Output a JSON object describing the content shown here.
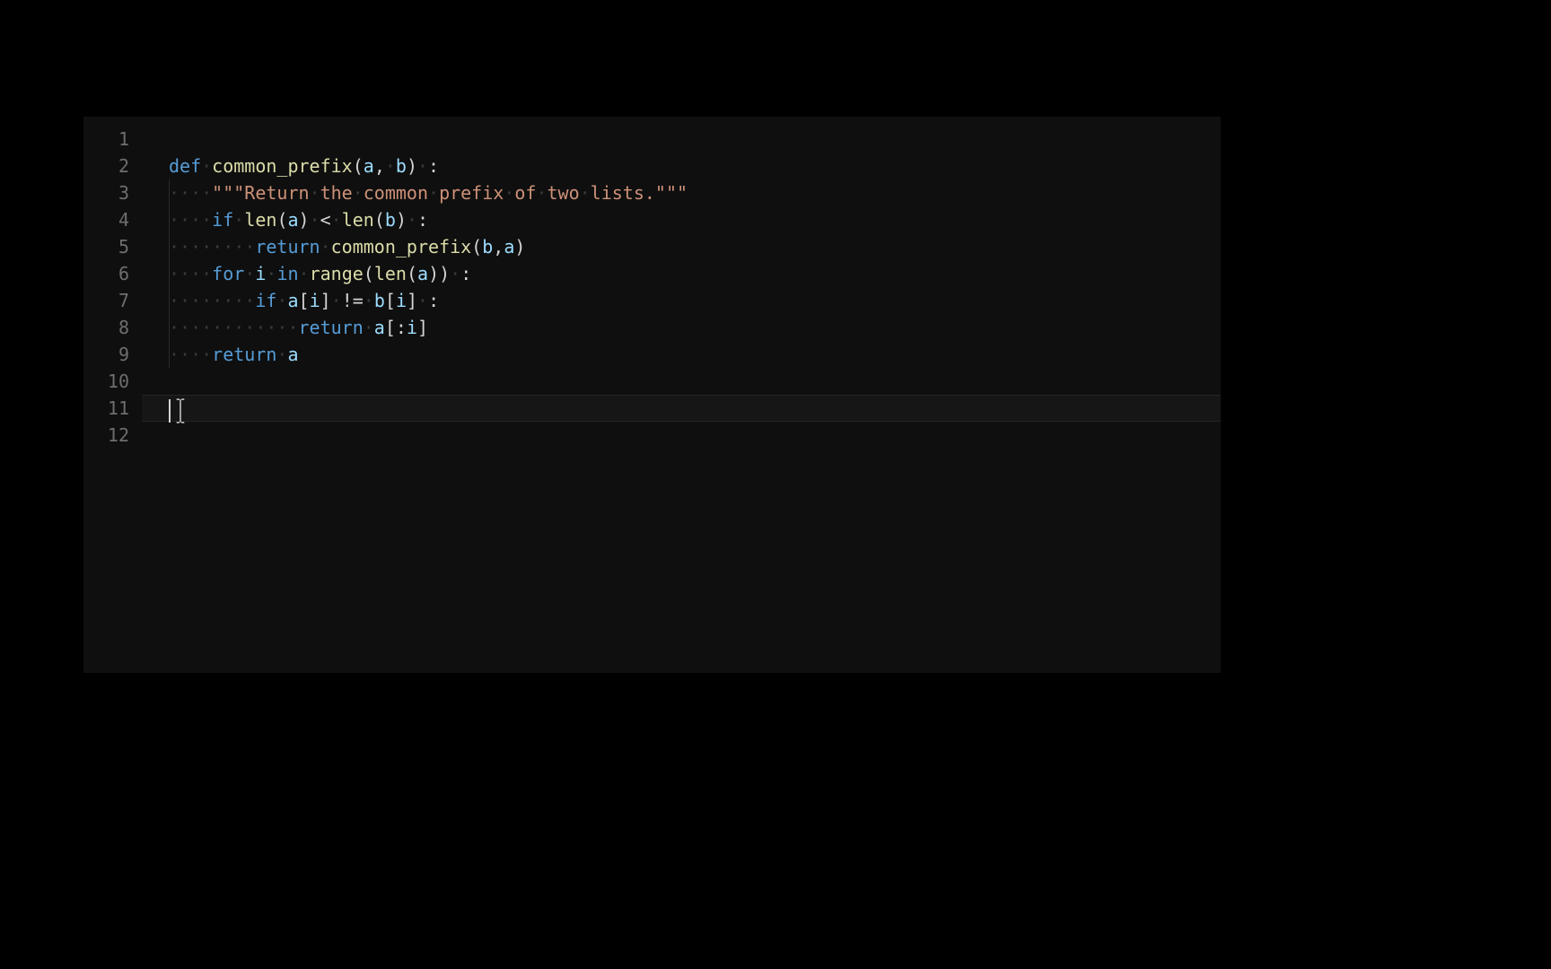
{
  "editor": {
    "active_line": 11,
    "gutter": [
      "1",
      "2",
      "3",
      "4",
      "5",
      "6",
      "7",
      "8",
      "9",
      "10",
      "11",
      "12"
    ],
    "code": {
      "line1": "",
      "line2": {
        "def": "def",
        "sp": " ",
        "fn": "common_prefix",
        "open": "(",
        "a": "a",
        "comma": ",",
        "sp2": " ",
        "b": "b",
        "close": ")",
        "sp3": " ",
        "colon": ":"
      },
      "line3": {
        "indent": "····",
        "docstring": "\"\"\"Return the common prefix of two lists.\"\"\""
      },
      "line4": {
        "indent": "····",
        "if": "if",
        "sp": " ",
        "len1": "len",
        "openA": "(",
        "a": "a",
        "closeA": ")",
        "sp2": " ",
        "lt": "<",
        "sp3": " ",
        "len2": "len",
        "openB": "(",
        "b": "b",
        "closeB": ")",
        "sp4": " ",
        "colon": ":"
      },
      "line5": {
        "indent": "········",
        "return": "return",
        "sp": " ",
        "fn": "common_prefix",
        "open": "(",
        "b": "b",
        "comma": ",",
        "a": "a",
        "close": ")"
      },
      "line6": {
        "indent": "····",
        "for": "for",
        "sp": " ",
        "i": "i",
        "sp2": " ",
        "in": "in",
        "sp3": " ",
        "range": "range",
        "open": "(",
        "len": "len",
        "open2": "(",
        "a": "a",
        "close2": ")",
        "close": ")",
        "sp4": " ",
        "colon": ":"
      },
      "line7": {
        "indent": "········",
        "if": "if",
        "sp": " ",
        "a": "a",
        "lb": "[",
        "i1": "i",
        "rb": "]",
        "sp2": " ",
        "neq": "!=",
        "sp3": " ",
        "b": "b",
        "lb2": "[",
        "i2": "i",
        "rb2": "]",
        "sp4": " ",
        "colon": ":"
      },
      "line8": {
        "indent": "············",
        "return": "return",
        "sp": " ",
        "a": "a",
        "lb": "[:",
        "i": "i",
        "rb": "]"
      },
      "line9": {
        "indent": "····",
        "return": "return",
        "sp": " ",
        "a": "a"
      },
      "line10": "",
      "line11": "",
      "line12": ""
    }
  }
}
